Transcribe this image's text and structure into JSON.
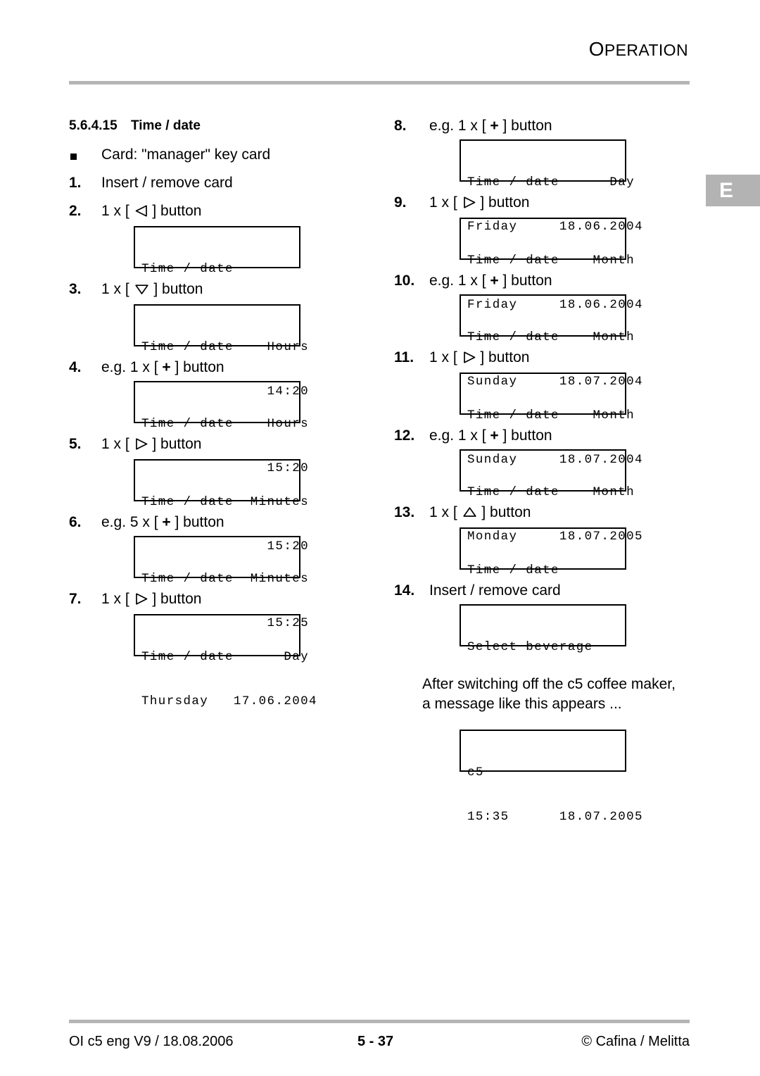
{
  "header": {
    "title_first": "O",
    "title_rest": "PERATION"
  },
  "lang_tab": {
    "label": "E"
  },
  "section": {
    "number": "5.6.4.15",
    "title": "Time / date"
  },
  "left_column": {
    "steps": [
      {
        "marker": "■",
        "marker_type": "square",
        "text": "Card: \"manager\" key card"
      },
      {
        "marker": "1.",
        "marker_type": "number",
        "text": "Insert / remove card"
      },
      {
        "marker": "2.",
        "marker_type": "number",
        "text_before": "1 x [",
        "icon": "triangle-left-icon",
        "text_after": "] button"
      },
      {
        "marker": "3.",
        "marker_type": "number",
        "text_before": "1 x [",
        "icon": "triangle-down-icon",
        "text_after": "] button"
      },
      {
        "marker": "4.",
        "marker_type": "number",
        "text_before": "e.g. 1 x [",
        "icon": "plus-icon",
        "text_after": "] button"
      },
      {
        "marker": "5.",
        "marker_type": "number",
        "text_before": "1 x [",
        "icon": "triangle-right-icon",
        "text_after": "] button"
      },
      {
        "marker": "6.",
        "marker_type": "number",
        "text_before": "e.g. 5 x [",
        "icon": "plus-icon",
        "text_after": "] button"
      },
      {
        "marker": "7.",
        "marker_type": "number",
        "text_before": "1 x [",
        "icon": "triangle-right-icon",
        "text_after": "] button"
      }
    ],
    "displays": [
      {
        "line1": "Time / date",
        "line2": ""
      },
      {
        "line1": "Time / date    Hours",
        "line2": "               14:20"
      },
      {
        "line1": "Time / date    Hours",
        "line2": "               15:20"
      },
      {
        "line1": "Time / date  Minutes",
        "line2": "               15:20"
      },
      {
        "line1": "Time / date  Minutes",
        "line2": "               15:25"
      },
      {
        "line1": "Time / date      Day",
        "line2": "Thursday   17.06.2004"
      }
    ]
  },
  "right_column": {
    "steps": [
      {
        "marker": "8.",
        "marker_type": "number",
        "text_before": "e.g. 1 x [",
        "icon": "plus-icon",
        "text_after": "] button"
      },
      {
        "marker": "9.",
        "marker_type": "number",
        "text_before": "1 x [",
        "icon": "triangle-right-icon",
        "text_after": "] button"
      },
      {
        "marker": "10.",
        "marker_type": "number",
        "text_before": "e.g. 1 x [",
        "icon": "plus-icon",
        "text_after": "] button"
      },
      {
        "marker": "11.",
        "marker_type": "number",
        "text_before": "1 x [",
        "icon": "triangle-right-icon",
        "text_after": "] button"
      },
      {
        "marker": "12.",
        "marker_type": "number",
        "text_before": "e.g. 1 x [",
        "icon": "plus-icon",
        "text_after": "] button"
      },
      {
        "marker": "13.",
        "marker_type": "number",
        "text_before": "1 x [",
        "icon": "triangle-up-icon",
        "text_after": "] button"
      },
      {
        "marker": "14.",
        "marker_type": "number",
        "text": "Insert / remove card"
      }
    ],
    "displays": [
      {
        "line1": "Time / date      Day",
        "line2": "Friday     18.06.2004"
      },
      {
        "line1": "Time / date    Month",
        "line2": "Friday     18.06.2004"
      },
      {
        "line1": "Time / date    Month",
        "line2": "Sunday     18.07.2004"
      },
      {
        "line1": "Time / date    Month",
        "line2": "Sunday     18.07.2004"
      },
      {
        "line1": "Time / date    Month",
        "line2": "Monday     18.07.2005"
      },
      {
        "line1": "Time / date",
        "line2": ""
      },
      {
        "line1": "Select beverage",
        "line2": ""
      }
    ],
    "note": "After switching off the c5 coffee maker,\na message like this appears ...",
    "note_display": {
      "line1": "c5",
      "line2": "15:35      18.07.2005"
    }
  },
  "footer": {
    "left": "OI c5 eng V9 / 18.08.2006",
    "center": "5 - 37",
    "right": "© Cafina / Melitta"
  }
}
